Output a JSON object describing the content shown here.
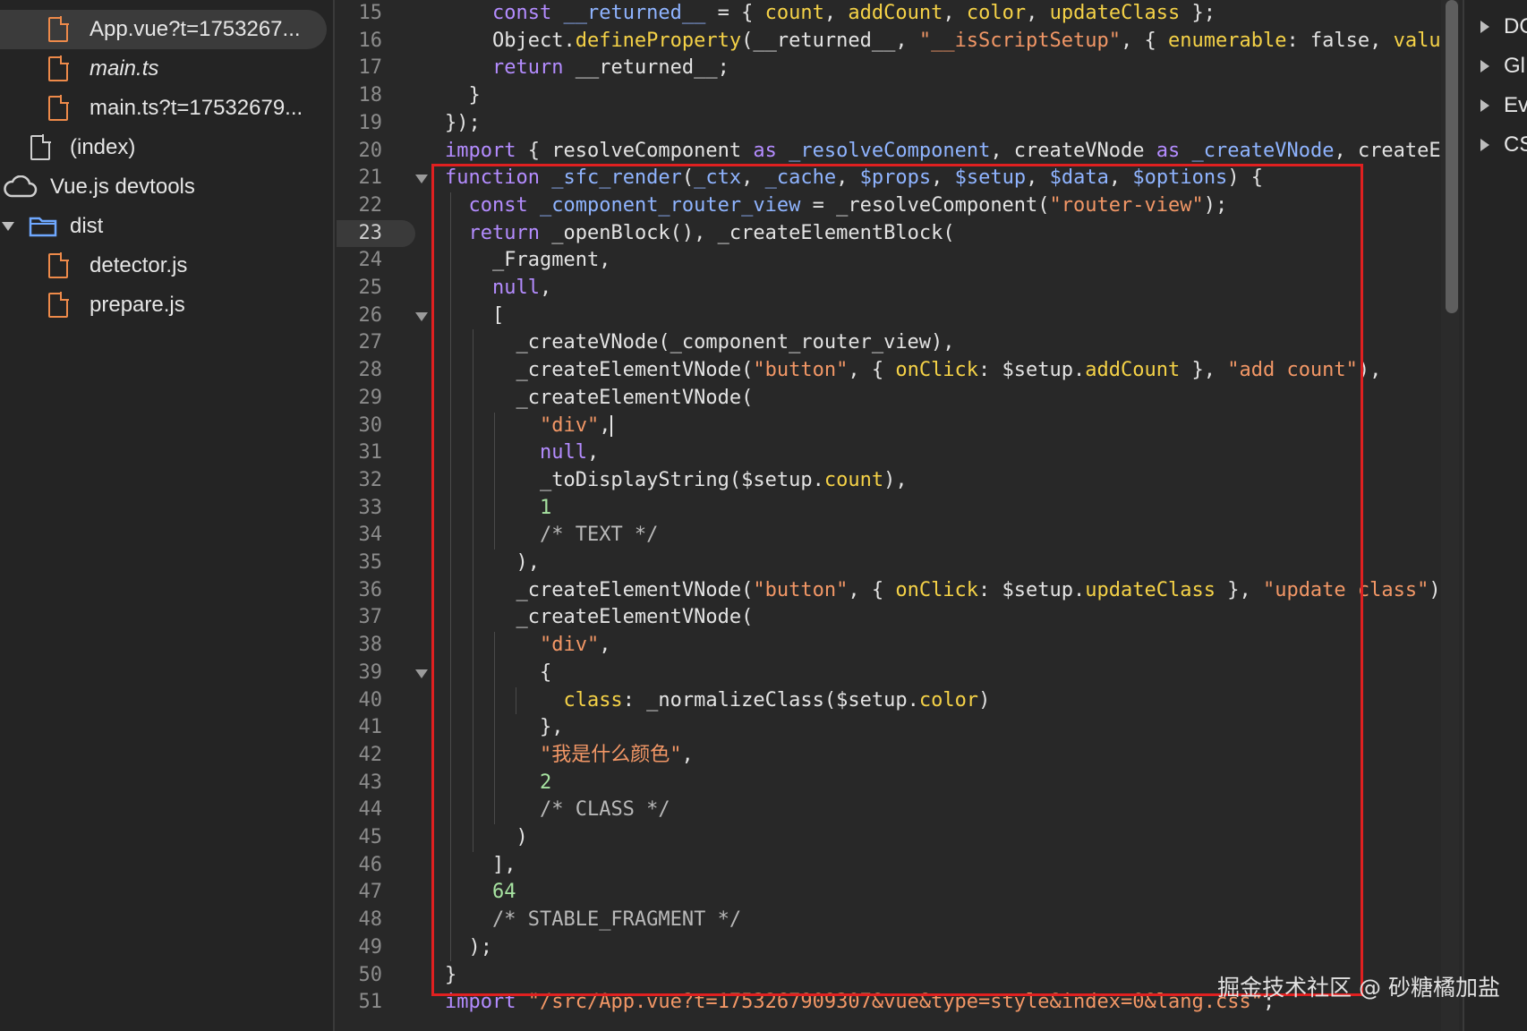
{
  "sidebar": {
    "items": [
      {
        "label": "App.vue?t=1753267...",
        "icon": "file-icon",
        "selected": true,
        "italic": false
      },
      {
        "label": "main.ts",
        "icon": "file-icon",
        "selected": false,
        "italic": true
      },
      {
        "label": "main.ts?t=17532679...",
        "icon": "file-icon",
        "selected": false,
        "italic": false
      },
      {
        "label": "(index)",
        "icon": "document-icon",
        "selected": false,
        "italic": false
      },
      {
        "label": "Vue.js devtools",
        "icon": "cloud-icon",
        "selected": false,
        "italic": false
      },
      {
        "label": "dist",
        "icon": "folder-icon",
        "selected": false,
        "italic": false,
        "expanded": true
      },
      {
        "label": "detector.js",
        "icon": "file-icon",
        "selected": false,
        "italic": false
      },
      {
        "label": "prepare.js",
        "icon": "file-icon",
        "selected": false,
        "italic": false
      }
    ]
  },
  "editor": {
    "current_line": 23,
    "fold_lines": [
      21,
      26,
      39
    ],
    "lines": [
      {
        "n": "15",
        "tokens": [
          [
            "pl",
            "    "
          ],
          [
            "kw",
            "const"
          ],
          [
            "pl",
            " "
          ],
          [
            "fn",
            "__returned__"
          ],
          [
            "pl",
            " = { "
          ],
          [
            "prop",
            "count"
          ],
          [
            "pl",
            ", "
          ],
          [
            "prop",
            "addCount"
          ],
          [
            "pl",
            ", "
          ],
          [
            "prop",
            "color"
          ],
          [
            "pl",
            ", "
          ],
          [
            "prop",
            "updateClass"
          ],
          [
            "pl",
            " };"
          ]
        ]
      },
      {
        "n": "16",
        "tokens": [
          [
            "pl",
            "    Object."
          ],
          [
            "prop",
            "defineProperty"
          ],
          [
            "pl",
            "(__returned__, "
          ],
          [
            "str",
            "\"__isScriptSetup\""
          ],
          [
            "pl",
            ", { "
          ],
          [
            "prop",
            "enumerable"
          ],
          [
            "pl",
            ": false, "
          ],
          [
            "prop",
            "valu"
          ]
        ]
      },
      {
        "n": "17",
        "tokens": [
          [
            "pl",
            "    "
          ],
          [
            "kw",
            "return"
          ],
          [
            "pl",
            " __returned__;"
          ]
        ]
      },
      {
        "n": "18",
        "tokens": [
          [
            "pl",
            "  }"
          ]
        ]
      },
      {
        "n": "19",
        "tokens": [
          [
            "pl",
            "});"
          ]
        ]
      },
      {
        "n": "20",
        "tokens": [
          [
            "kw",
            "import"
          ],
          [
            "pl",
            " { resolveComponent "
          ],
          [
            "kw",
            "as"
          ],
          [
            "pl",
            " "
          ],
          [
            "fn",
            "_resolveComponent"
          ],
          [
            "pl",
            ", createVNode "
          ],
          [
            "kw",
            "as"
          ],
          [
            "pl",
            " "
          ],
          [
            "fn",
            "_createVNode"
          ],
          [
            "pl",
            ", createE"
          ]
        ]
      },
      {
        "n": "21",
        "tokens": [
          [
            "kw",
            "function"
          ],
          [
            "pl",
            " "
          ],
          [
            "fn",
            "_sfc_render"
          ],
          [
            "pl",
            "("
          ],
          [
            "fn",
            "_ctx"
          ],
          [
            "pl",
            ", "
          ],
          [
            "fn",
            "_cache"
          ],
          [
            "pl",
            ", "
          ],
          [
            "fn",
            "$props"
          ],
          [
            "pl",
            ", "
          ],
          [
            "fn",
            "$setup"
          ],
          [
            "pl",
            ", "
          ],
          [
            "fn",
            "$data"
          ],
          [
            "pl",
            ", "
          ],
          [
            "fn",
            "$options"
          ],
          [
            "pl",
            ") {"
          ]
        ]
      },
      {
        "n": "22",
        "tokens": [
          [
            "pl",
            "  "
          ],
          [
            "kw",
            "const"
          ],
          [
            "pl",
            " "
          ],
          [
            "fn",
            "_component_router_view"
          ],
          [
            "pl",
            " = _resolveComponent("
          ],
          [
            "str",
            "\"router-view\""
          ],
          [
            "pl",
            ");"
          ]
        ]
      },
      {
        "n": "23",
        "tokens": [
          [
            "pl",
            "  "
          ],
          [
            "kw",
            "return"
          ],
          [
            "pl",
            " _openBlock(), _createElementBlock("
          ]
        ]
      },
      {
        "n": "24",
        "tokens": [
          [
            "pl",
            "    _Fragment,"
          ]
        ]
      },
      {
        "n": "25",
        "tokens": [
          [
            "pl",
            "    "
          ],
          [
            "kw",
            "null"
          ],
          [
            "pl",
            ","
          ]
        ]
      },
      {
        "n": "26",
        "tokens": [
          [
            "pl",
            "    ["
          ]
        ]
      },
      {
        "n": "27",
        "tokens": [
          [
            "pl",
            "      _createVNode(_component_router_view),"
          ]
        ]
      },
      {
        "n": "28",
        "tokens": [
          [
            "pl",
            "      _createElementVNode("
          ],
          [
            "str",
            "\"button\""
          ],
          [
            "pl",
            ", { "
          ],
          [
            "prop",
            "onClick"
          ],
          [
            "pl",
            ": $setup."
          ],
          [
            "prop",
            "addCount"
          ],
          [
            "pl",
            " }, "
          ],
          [
            "str",
            "\"add count\""
          ],
          [
            "pl",
            "),"
          ]
        ]
      },
      {
        "n": "29",
        "tokens": [
          [
            "pl",
            "      _createElementVNode("
          ]
        ]
      },
      {
        "n": "30",
        "tokens": [
          [
            "pl",
            "        "
          ],
          [
            "str",
            "\"div\""
          ],
          [
            "pl",
            ","
          ]
        ],
        "cursor": true
      },
      {
        "n": "31",
        "tokens": [
          [
            "pl",
            "        "
          ],
          [
            "kw",
            "null"
          ],
          [
            "pl",
            ","
          ]
        ]
      },
      {
        "n": "32",
        "tokens": [
          [
            "pl",
            "        _toDisplayString($setup."
          ],
          [
            "prop",
            "count"
          ],
          [
            "pl",
            "),"
          ]
        ]
      },
      {
        "n": "33",
        "tokens": [
          [
            "pl",
            "        "
          ],
          [
            "num",
            "1"
          ]
        ]
      },
      {
        "n": "34",
        "tokens": [
          [
            "pl",
            "        "
          ],
          [
            "cm",
            "/* TEXT */"
          ]
        ]
      },
      {
        "n": "35",
        "tokens": [
          [
            "pl",
            "      ),"
          ]
        ]
      },
      {
        "n": "36",
        "tokens": [
          [
            "pl",
            "      _createElementVNode("
          ],
          [
            "str",
            "\"button\""
          ],
          [
            "pl",
            ", { "
          ],
          [
            "prop",
            "onClick"
          ],
          [
            "pl",
            ": $setup."
          ],
          [
            "prop",
            "updateClass"
          ],
          [
            "pl",
            " }, "
          ],
          [
            "str",
            "\"update class\""
          ],
          [
            "pl",
            ")"
          ]
        ]
      },
      {
        "n": "37",
        "tokens": [
          [
            "pl",
            "      _createElementVNode("
          ]
        ]
      },
      {
        "n": "38",
        "tokens": [
          [
            "pl",
            "        "
          ],
          [
            "str",
            "\"div\""
          ],
          [
            "pl",
            ","
          ]
        ]
      },
      {
        "n": "39",
        "tokens": [
          [
            "pl",
            "        {"
          ]
        ]
      },
      {
        "n": "40",
        "tokens": [
          [
            "pl",
            "          "
          ],
          [
            "prop",
            "class"
          ],
          [
            "pl",
            ": _normalizeClass($setup."
          ],
          [
            "prop",
            "color"
          ],
          [
            "pl",
            ")"
          ]
        ]
      },
      {
        "n": "41",
        "tokens": [
          [
            "pl",
            "        },"
          ]
        ]
      },
      {
        "n": "42",
        "tokens": [
          [
            "pl",
            "        "
          ],
          [
            "str",
            "\"我是什么颜色\""
          ],
          [
            "pl",
            ","
          ]
        ]
      },
      {
        "n": "43",
        "tokens": [
          [
            "pl",
            "        "
          ],
          [
            "num",
            "2"
          ]
        ]
      },
      {
        "n": "44",
        "tokens": [
          [
            "pl",
            "        "
          ],
          [
            "cm",
            "/* CLASS */"
          ]
        ]
      },
      {
        "n": "45",
        "tokens": [
          [
            "pl",
            "      )"
          ]
        ]
      },
      {
        "n": "46",
        "tokens": [
          [
            "pl",
            "    ],"
          ]
        ]
      },
      {
        "n": "47",
        "tokens": [
          [
            "pl",
            "    "
          ],
          [
            "num",
            "64"
          ]
        ]
      },
      {
        "n": "48",
        "tokens": [
          [
            "pl",
            "    "
          ],
          [
            "cm",
            "/* STABLE_FRAGMENT */"
          ]
        ]
      },
      {
        "n": "49",
        "tokens": [
          [
            "pl",
            "  );"
          ]
        ]
      },
      {
        "n": "50",
        "tokens": [
          [
            "pl",
            "}"
          ]
        ]
      },
      {
        "n": "51",
        "tokens": [
          [
            "kw",
            "import"
          ],
          [
            "pl",
            " "
          ],
          [
            "str",
            "\"/src/App.vue?t=1753267909307&vue&type=style&index=0&lang.css\""
          ],
          [
            "pl",
            ";"
          ]
        ]
      }
    ]
  },
  "right_panel": {
    "items": [
      {
        "label": "DO"
      },
      {
        "label": "Gl"
      },
      {
        "label": "Ev"
      },
      {
        "label": "CS"
      }
    ]
  },
  "watermark": "掘金技术社区 @ 砂糖橘加盐",
  "colors": {
    "keyword": "#b48cff",
    "identifier": "#8fb4ff",
    "string": "#f29766",
    "property": "#f5d247",
    "number": "#a7e3a1",
    "highlight_box": "#e02020",
    "file_icon": "#ee8a4a"
  }
}
